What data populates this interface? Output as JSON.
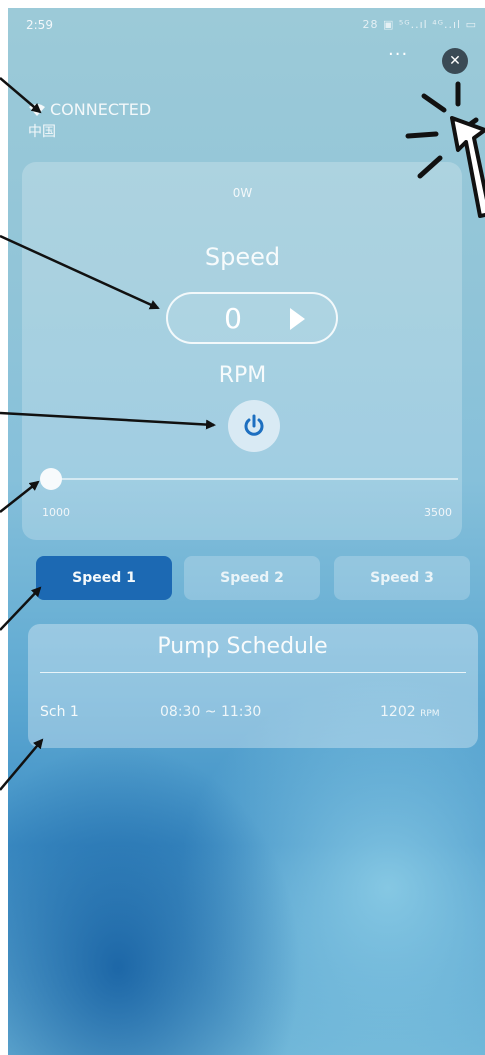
{
  "status_bar": {
    "time": "2:59",
    "icons": "28 ▣ ⁵ᴳ..ıl ⁴ᴳ..ıl ▭"
  },
  "header": {
    "more_label": "···",
    "close_label": "✕"
  },
  "connection": {
    "status": "CONNECTED",
    "region": "中国"
  },
  "pump": {
    "power": "0W",
    "speed_label": "Speed",
    "speed_value": "0",
    "rpm_label": "RPM",
    "slider": {
      "min_label": "1000",
      "max_label": "3500",
      "value": 1000,
      "min": 1000,
      "max": 3500
    }
  },
  "speed_tabs": [
    {
      "label": "Speed 1",
      "active": true
    },
    {
      "label": "Speed 2",
      "active": false
    },
    {
      "label": "Speed 3",
      "active": false
    }
  ],
  "schedule": {
    "title": "Pump Schedule",
    "rows": [
      {
        "name": "Sch 1",
        "time": "08:30 ~ 11:30",
        "rpm": "1202",
        "unit": "RPM"
      }
    ]
  },
  "colors": {
    "accent": "#1c69b3",
    "power_icon": "#1d6fc0",
    "annotation": "#111111"
  }
}
